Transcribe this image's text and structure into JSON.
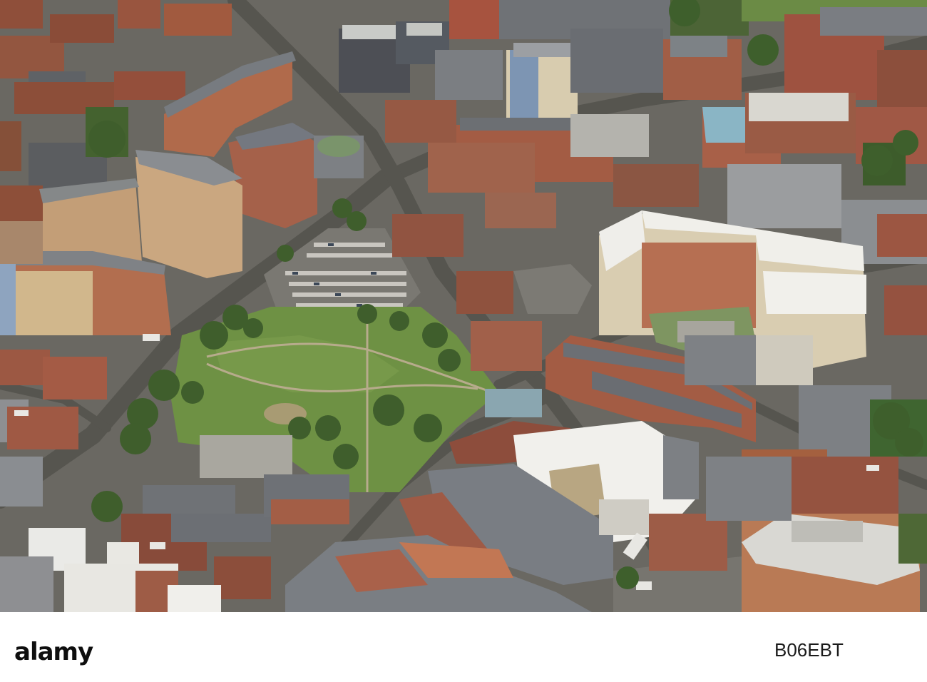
{
  "image": {
    "description_type": "aerial-photograph",
    "stock_watermark": "alamy",
    "stock_code": "B06EBT"
  },
  "palette": {
    "brick": "#9b5a44",
    "roof_grey": "#6f7378",
    "grass": "#6f9244",
    "trees": "#3f5e2c",
    "white_roof": "#e9e8e3",
    "road": "#5b5a57",
    "car_park": "#7a7872"
  }
}
